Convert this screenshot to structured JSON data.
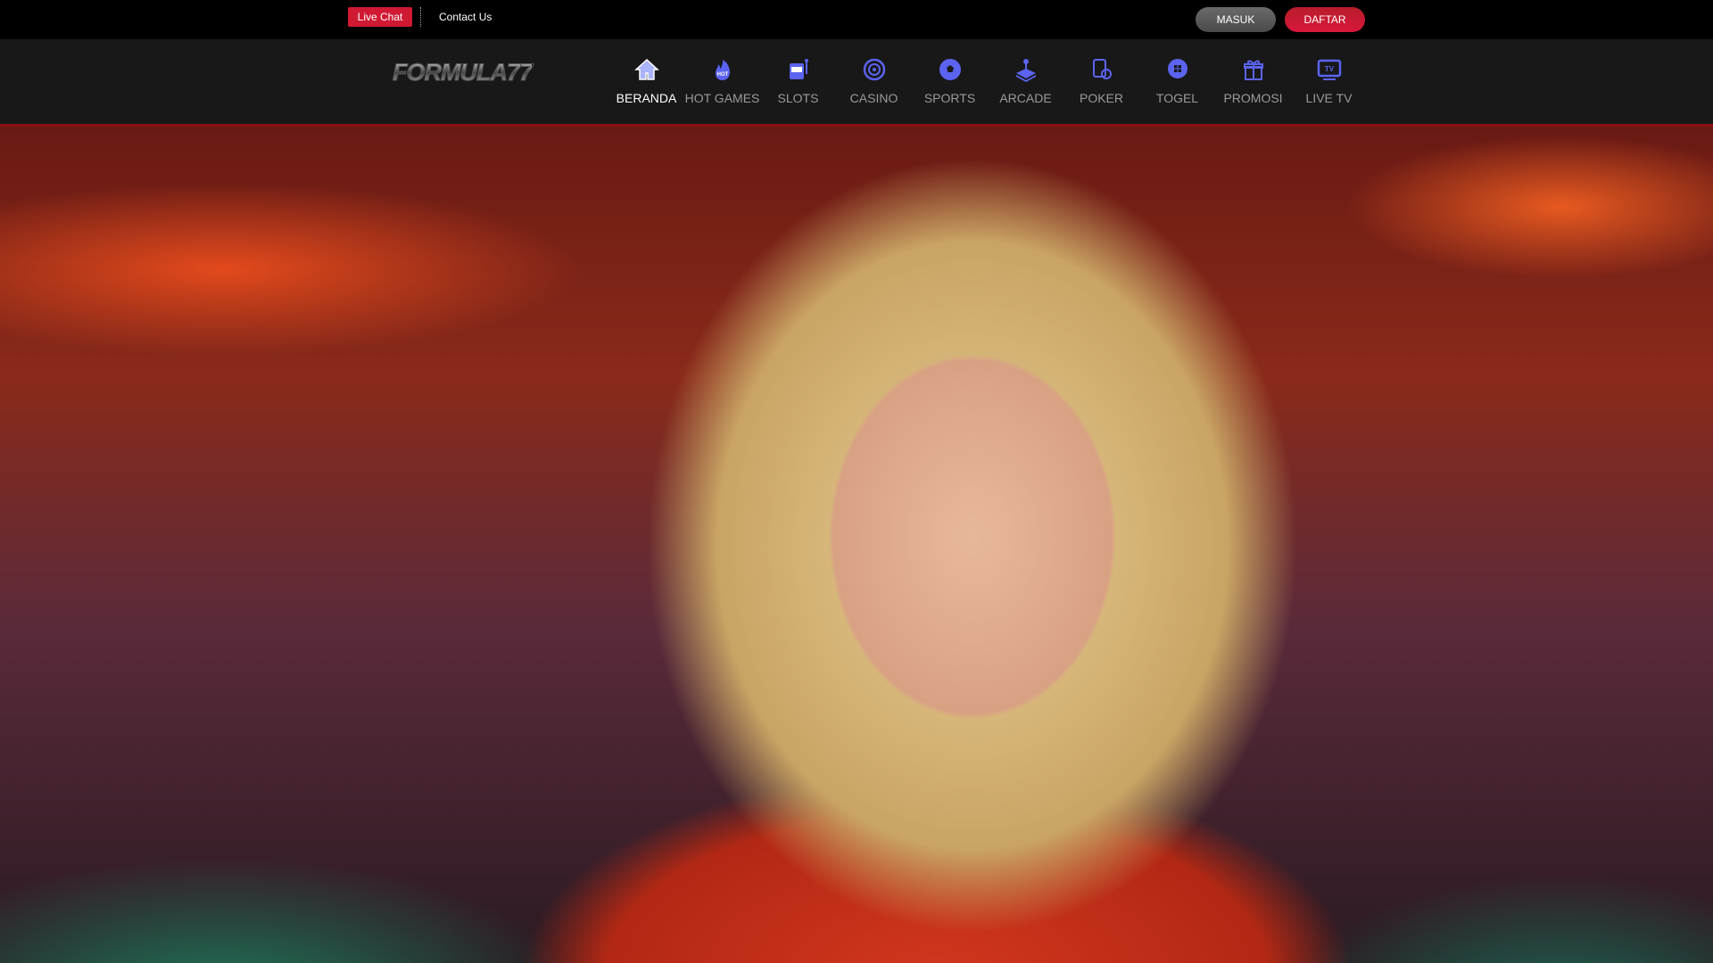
{
  "topbar": {
    "live_chat": "Live Chat",
    "contact_us": "Contact Us",
    "login": "MASUK",
    "register": "DAFTAR"
  },
  "brand": {
    "logo_text": "FORMULA77"
  },
  "nav": {
    "items": [
      {
        "label": "BERANDA",
        "icon": "home-icon",
        "active": true
      },
      {
        "label": "HOT GAMES",
        "icon": "fire-icon"
      },
      {
        "label": "SLOTS",
        "icon": "slot-machine-icon"
      },
      {
        "label": "CASINO",
        "icon": "roulette-icon"
      },
      {
        "label": "SPORTS",
        "icon": "soccer-ball-icon"
      },
      {
        "label": "ARCADE",
        "icon": "joystick-icon"
      },
      {
        "label": "POKER",
        "icon": "poker-cards-icon"
      },
      {
        "label": "TOGEL",
        "icon": "lottery-ball-icon"
      },
      {
        "label": "PROMOSI",
        "icon": "gift-icon"
      },
      {
        "label": "LIVE TV",
        "icon": "tv-icon"
      }
    ]
  },
  "colors": {
    "accent": "#5b63f0",
    "brand_red": "#d01a33",
    "nav_bg": "#181818"
  }
}
